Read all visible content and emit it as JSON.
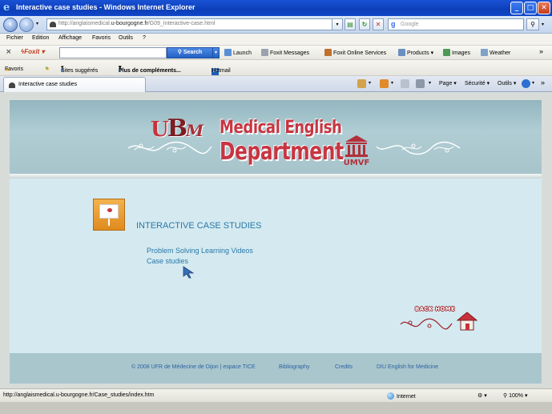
{
  "window": {
    "title": "Interactive case studies - Windows Internet Explorer",
    "minimize": "_",
    "maximize": "□",
    "close": "✕"
  },
  "address": {
    "url_prefix": "http://anglaismedical.",
    "url_domain": "u-bourgogne.fr",
    "url_path": "/G09_Interactive-case.html",
    "search_placeholder": "Google",
    "search_engine_glyph": "g"
  },
  "menu": [
    "Fichier",
    "Edition",
    "Affichage",
    "Favoris",
    "Outils",
    "?"
  ],
  "foxit_toolbar": {
    "logo": "Foxit",
    "search_label": "Search",
    "items": [
      "Launch",
      "Foxit Messages",
      "Foxit Online Services",
      "Products",
      "Images",
      "Weather"
    ]
  },
  "favorites_bar": {
    "favorites": "Favoris",
    "suggested": "Sites suggérés",
    "more": "Plus de compléments...",
    "hotmail": "Hotmail"
  },
  "tab": {
    "label": "Interactive case studies"
  },
  "commands": {
    "page": "Page",
    "security": "Sécurité",
    "tools": "Outils"
  },
  "site": {
    "header_line1": "Medical English",
    "header_line2": "Department",
    "logo_u": "U",
    "logo_b": "B",
    "logo_m": "M",
    "umvf": "UMVF",
    "section_title": "INTERACTIVE CASE STUDIES",
    "links": [
      "Problem Solving Learning Videos",
      "Case studies"
    ],
    "back_home": "BACK HOME",
    "footer": {
      "copyright": "© 2008 UFR de Médecine de Dijon | espace TICE",
      "bibliography": "Bibliography",
      "credits": "Credits",
      "diu": "DIU English for Medicine"
    }
  },
  "status": {
    "url": "http://anglaismedical.u-bourgogne.fr/Case_studies/index.htm",
    "zone": "Internet",
    "zoom": "100%"
  },
  "colors": {
    "titlebar": "#0c3eb8",
    "header_red": "#c73541",
    "link_blue": "#2a78a9",
    "site_bg": "#d4eaf0"
  }
}
